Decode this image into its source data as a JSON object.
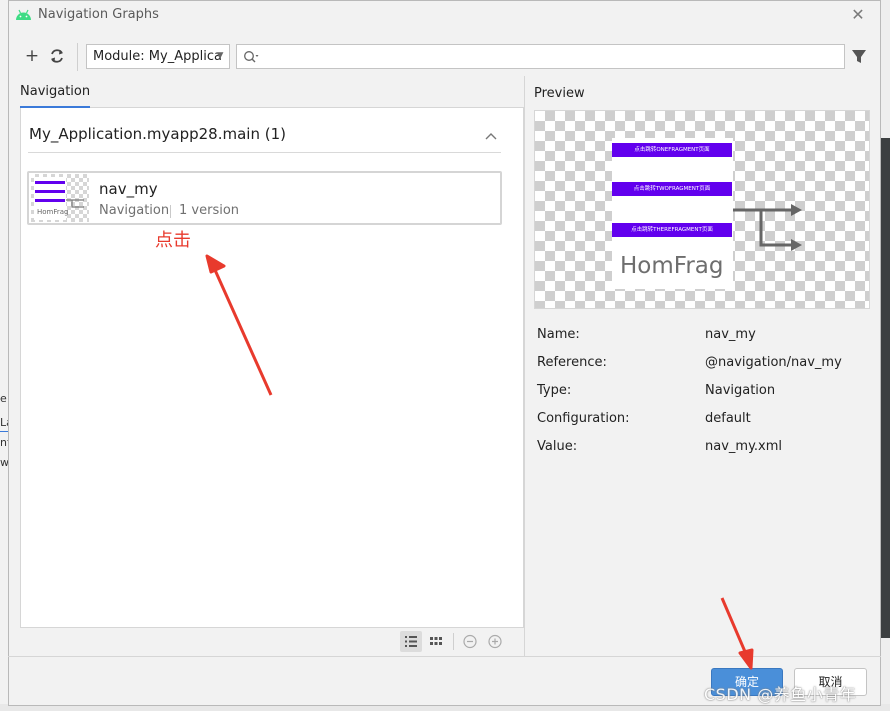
{
  "dialog": {
    "title": "Navigation Graphs",
    "close_icon": "close-icon"
  },
  "toolbar": {
    "add_icon": "plus-icon",
    "refresh_icon": "refresh-icon",
    "module_select": "Module: My_Applica",
    "search_value": "",
    "filter_icon": "filter-icon"
  },
  "left_panel": {
    "tab": "Navigation",
    "group_title": "My_Application.myapp28.main (1)",
    "item": {
      "name": "nav_my",
      "type": "Navigation",
      "version": "1 version",
      "thumb_label": "HomFrag"
    },
    "annotation": "点击"
  },
  "preview": {
    "label": "Preview",
    "buttons": [
      "点击跳转ONEFRAGMENT页面",
      "点击跳转TWOFRAGMENT页面",
      "点击跳转THEREFRAGMENT页面"
    ],
    "fragment_label": "HomFrag"
  },
  "properties": [
    {
      "label": "Name:",
      "value": "nav_my"
    },
    {
      "label": "Reference:",
      "value": "@navigation/nav_my"
    },
    {
      "label": "Type:",
      "value": "Navigation"
    },
    {
      "label": "Configuration:",
      "value": "default"
    },
    {
      "label": "Value:",
      "value": "nav_my.xml"
    }
  ],
  "footer": {
    "ok": "确定",
    "cancel": "取消"
  },
  "watermark": "CSDN @养鱼小青年",
  "background_fragments": [
    "e",
    "La",
    "nt",
    "w"
  ],
  "colors": {
    "accent": "#3b7ad9",
    "primary_button": "#4a8fd9",
    "android_green": "#3ddc84",
    "purple": "#6200ee",
    "annotation_red": "#e83a2d"
  }
}
